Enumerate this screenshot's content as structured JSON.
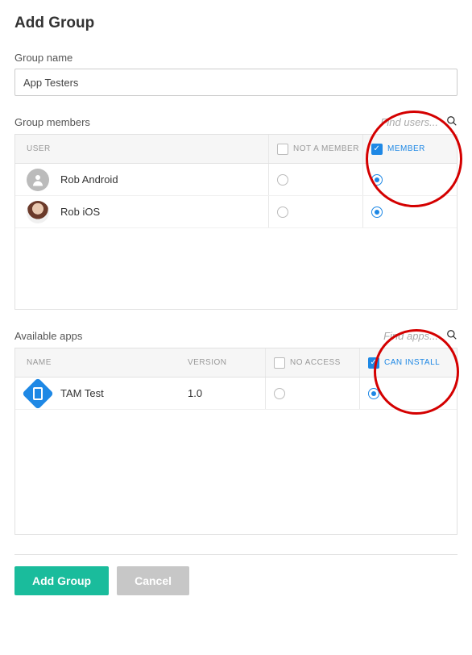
{
  "title": "Add Group",
  "group_name_label": "Group name",
  "group_name_value": "App Testers",
  "members": {
    "title": "Group members",
    "search_placeholder": "Find users...",
    "headers": {
      "user": "USER",
      "not_member": "NOT A MEMBER",
      "member": "MEMBER"
    },
    "rows": [
      {
        "name": "Rob Android",
        "member": true
      },
      {
        "name": "Rob iOS",
        "member": true
      }
    ]
  },
  "apps": {
    "title": "Available apps",
    "search_placeholder": "Find apps...",
    "headers": {
      "name": "NAME",
      "version": "VERSION",
      "no_access": "NO ACCESS",
      "can_install": "CAN INSTALL"
    },
    "rows": [
      {
        "name": "TAM Test",
        "version": "1.0",
        "can_install": true
      }
    ]
  },
  "buttons": {
    "primary": "Add Group",
    "cancel": "Cancel"
  }
}
